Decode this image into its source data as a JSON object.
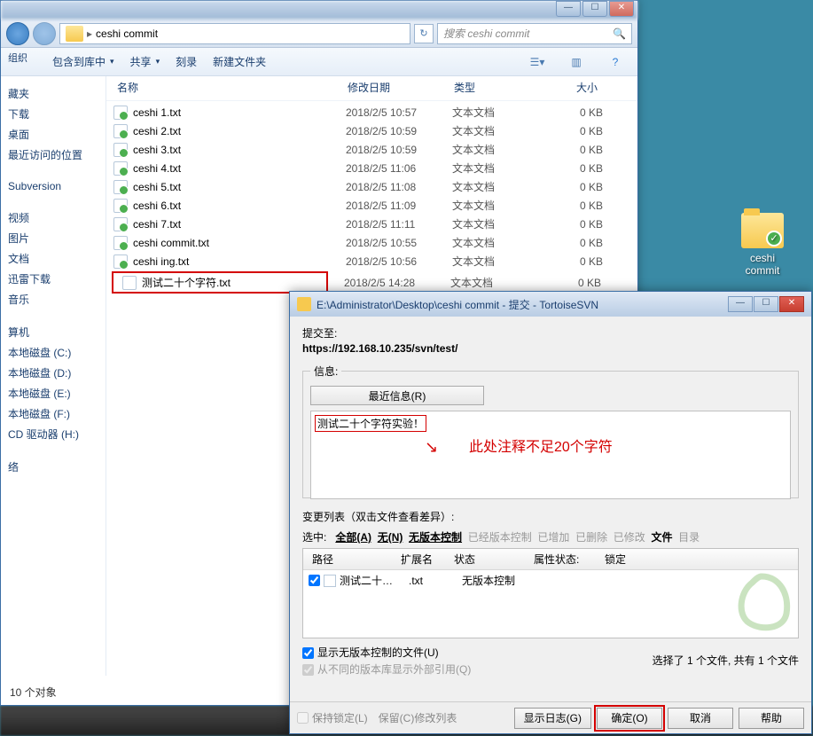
{
  "desktop": {
    "icon_label": "ceshi\ncommit"
  },
  "explorer": {
    "breadcrumb": "ceshi commit",
    "search_placeholder": "搜索 ceshi commit",
    "toolbar": {
      "organize": "组织",
      "include": "包含到库中",
      "share": "共享",
      "burn": "刻录",
      "newfolder": "新建文件夹"
    },
    "columns": {
      "name": "名称",
      "date": "修改日期",
      "type": "类型",
      "size": "大小"
    },
    "sidebar": {
      "g1": [
        "藏夹",
        "下载",
        "桌面",
        "最近访问的位置"
      ],
      "g2": [
        "Subversion"
      ],
      "g3": [
        "视频",
        "图片",
        "文档",
        "迅雷下载",
        "音乐"
      ],
      "g4": [
        "算机",
        "本地磁盘 (C:)",
        "本地磁盘 (D:)",
        "本地磁盘 (E:)",
        "本地磁盘 (F:)",
        "CD 驱动器 (H:)"
      ],
      "g5": [
        "络"
      ]
    },
    "files": [
      {
        "n": "ceshi 1.txt",
        "d": "2018/2/5 10:57",
        "t": "文本文档",
        "s": "0 KB",
        "ok": true
      },
      {
        "n": "ceshi 2.txt",
        "d": "2018/2/5 10:59",
        "t": "文本文档",
        "s": "0 KB",
        "ok": true
      },
      {
        "n": "ceshi 3.txt",
        "d": "2018/2/5 10:59",
        "t": "文本文档",
        "s": "0 KB",
        "ok": true
      },
      {
        "n": "ceshi 4.txt",
        "d": "2018/2/5 11:06",
        "t": "文本文档",
        "s": "0 KB",
        "ok": true
      },
      {
        "n": "ceshi 5.txt",
        "d": "2018/2/5 11:08",
        "t": "文本文档",
        "s": "0 KB",
        "ok": true
      },
      {
        "n": "ceshi 6.txt",
        "d": "2018/2/5 11:09",
        "t": "文本文档",
        "s": "0 KB",
        "ok": true
      },
      {
        "n": "ceshi 7.txt",
        "d": "2018/2/5 11:11",
        "t": "文本文档",
        "s": "0 KB",
        "ok": true
      },
      {
        "n": "ceshi commit.txt",
        "d": "2018/2/5 10:55",
        "t": "文本文档",
        "s": "0 KB",
        "ok": true
      },
      {
        "n": "ceshi ing.txt",
        "d": "2018/2/5 10:56",
        "t": "文本文档",
        "s": "0 KB",
        "ok": true
      },
      {
        "n": "测试二十个字符.txt",
        "d": "2018/2/5 14:28",
        "t": "文本文档",
        "s": "0 KB",
        "ok": false,
        "hl": true
      }
    ],
    "status": "10 个对象"
  },
  "svn": {
    "title": "E:\\Administrator\\Desktop\\ceshi commit - 提交 - TortoiseSVN",
    "commit_to": "提交至:",
    "url": "https://192.168.10.235/svn/test/",
    "info_legend": "信息:",
    "recent_btn": "最近信息(R)",
    "msg": "测试二十个字符实验！",
    "annotation": "此处注释不足20个字符",
    "changelist": "变更列表（双击文件查看差异）:",
    "filter_label": "选中:",
    "filters": {
      "all": "全部(A)",
      "none": "无(N)",
      "unver": "无版本控制",
      "verctrl": "已经版本控制",
      "added": "已增加",
      "deleted": "已删除",
      "modified": "已修改",
      "files": "文件",
      "dirs": "目录"
    },
    "fl_cols": {
      "path": "路径",
      "ext": "扩展名",
      "status": "状态",
      "prop": "属性状态:",
      "lock": "锁定"
    },
    "fl_row": {
      "path": "测试二十…",
      "ext": ".txt",
      "status": "无版本控制"
    },
    "show_unver": "显示无版本控制的文件(U)",
    "show_ext": "从不同的版本库显示外部引用(Q)",
    "selection_info": "选择了 1 个文件, 共有 1 个文件",
    "keep_lock": "保持锁定(L)",
    "keep_cl": "保留(C)修改列表",
    "btn_log": "显示日志(G)",
    "btn_ok": "确定(O)",
    "btn_cancel": "取消",
    "btn_help": "帮助"
  }
}
